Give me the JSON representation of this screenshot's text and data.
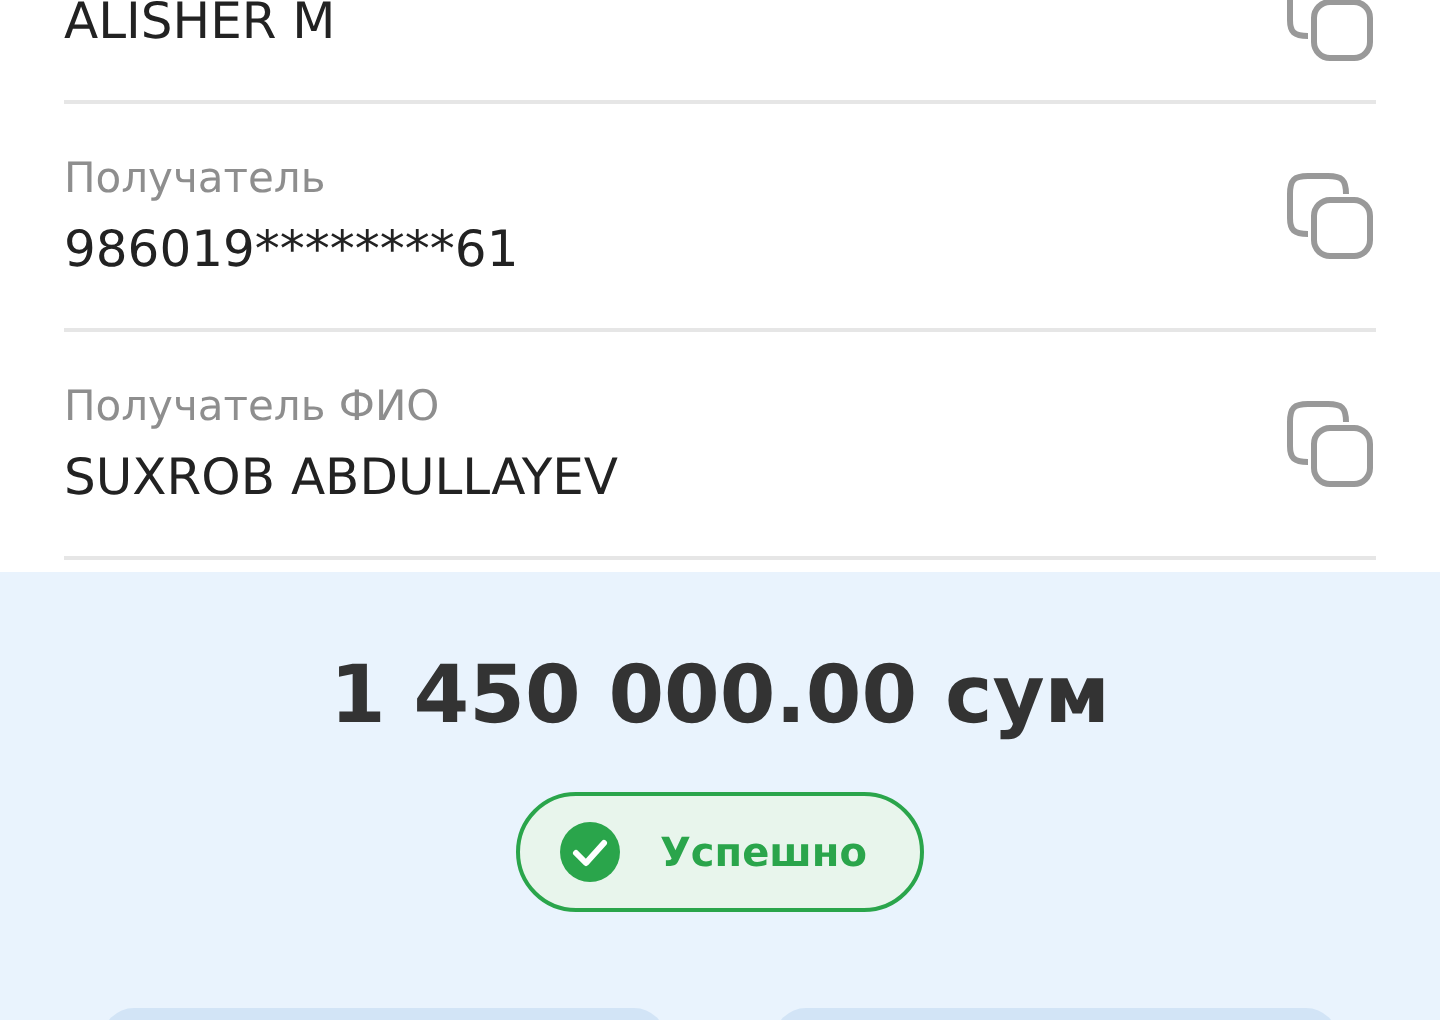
{
  "details": [
    {
      "value": "ALISHER M"
    },
    {
      "label": "Получатель",
      "value": "986019********61"
    },
    {
      "label": "Получатель ФИО",
      "value": "SUXROB ABDULLAYEV"
    }
  ],
  "amount": "1 450 000.00 сум",
  "status": {
    "kind": "success",
    "text": "Успешно"
  }
}
